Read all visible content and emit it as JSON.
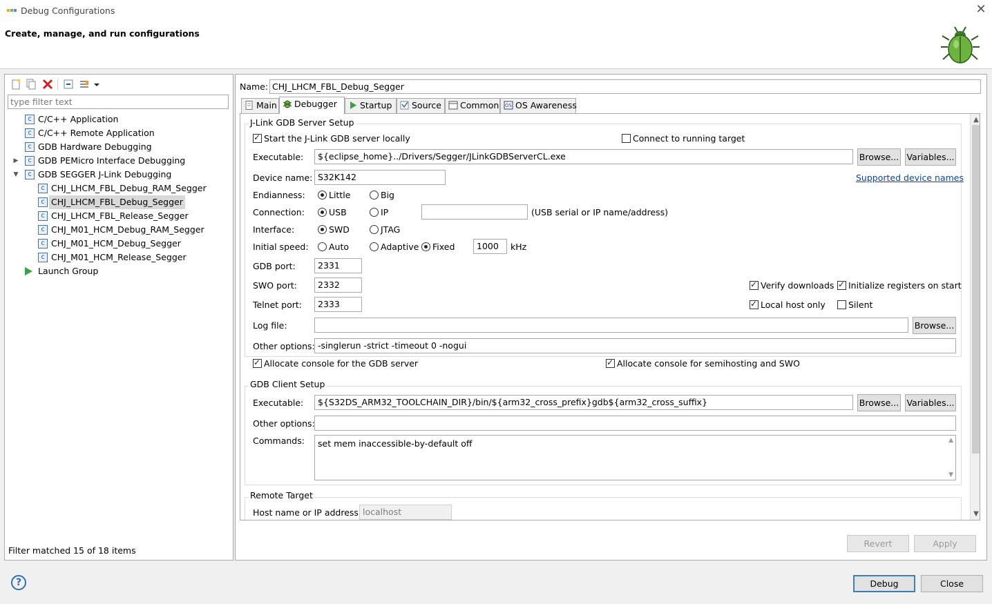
{
  "window": {
    "title": "Debug Configurations",
    "close_icon": "close-icon"
  },
  "header": {
    "title": "Create, manage, and run configurations"
  },
  "left": {
    "filter_placeholder": "type filter text",
    "tree": [
      {
        "label": "C/C++ Application",
        "level": 1
      },
      {
        "label": "C/C++ Remote Application",
        "level": 1
      },
      {
        "label": "GDB Hardware Debugging",
        "level": 1
      },
      {
        "label": "GDB PEMicro Interface Debugging",
        "level": 1,
        "expander": "collapsed"
      },
      {
        "label": "GDB SEGGER J-Link Debugging",
        "level": 1,
        "expander": "expanded"
      },
      {
        "label": "CHJ_LHCM_FBL_Debug_RAM_Segger",
        "level": 2
      },
      {
        "label": "CHJ_LHCM_FBL_Debug_Segger",
        "level": 2,
        "selected": true
      },
      {
        "label": "CHJ_LHCM_FBL_Release_Segger",
        "level": 2
      },
      {
        "label": "CHJ_M01_HCM_Debug_RAM_Segger",
        "level": 2
      },
      {
        "label": "CHJ_M01_HCM_Debug_Segger",
        "level": 2
      },
      {
        "label": "CHJ_M01_HCM_Release_Segger",
        "level": 2
      },
      {
        "label": "Launch Group",
        "level": 1
      }
    ],
    "status": "Filter matched 15 of 18 items"
  },
  "right": {
    "name_label": "Name:",
    "name_value": "CHJ_LHCM_FBL_Debug_Segger",
    "tabs": [
      "Main",
      "Debugger",
      "Startup",
      "Source",
      "Common",
      "OS Awareness"
    ],
    "active_tab": "Debugger",
    "server": {
      "group_title": "J-Link GDB Server Setup",
      "start_locally": "Start the J-Link GDB server locally",
      "connect_running": "Connect to running target",
      "executable_label": "Executable:",
      "executable_value": "${eclipse_home}../Drivers/Segger/JLinkGDBServerCL.exe",
      "browse": "Browse...",
      "variables": "Variables...",
      "device_label": "Device name:",
      "device_value": "S32K142",
      "supported_link": "Supported device names",
      "endian_label": "Endianness:",
      "endian_little": "Little",
      "endian_big": "Big",
      "conn_label": "Connection:",
      "conn_usb": "USB",
      "conn_ip": "IP",
      "conn_hint": "(USB serial or IP name/address)",
      "iface_label": "Interface:",
      "iface_swd": "SWD",
      "iface_jtag": "JTAG",
      "speed_label": "Initial speed:",
      "speed_auto": "Auto",
      "speed_adaptive": "Adaptive",
      "speed_fixed": "Fixed",
      "speed_value": "1000",
      "speed_unit": "kHz",
      "gdb_port_label": "GDB port:",
      "gdb_port": "2331",
      "swo_port_label": "SWO port:",
      "swo_port": "2332",
      "telnet_port_label": "Telnet port:",
      "telnet_port": "2333",
      "verify": "Verify downloads",
      "init_regs": "Initialize registers on start",
      "local_only": "Local host only",
      "silent": "Silent",
      "log_label": "Log file:",
      "log_browse": "Browse...",
      "other_label": "Other options:",
      "other_value": "-singlerun -strict -timeout 0 -nogui",
      "alloc_gdb": "Allocate console for the GDB server",
      "alloc_semi": "Allocate console for semihosting and SWO"
    },
    "client": {
      "group_title": "GDB Client Setup",
      "executable_label": "Executable:",
      "executable_value": "${S32DS_ARM32_TOOLCHAIN_DIR}/bin/${arm32_cross_prefix}gdb${arm32_cross_suffix}",
      "browse": "Browse...",
      "variables": "Variables...",
      "other_label": "Other options:",
      "commands_label": "Commands:",
      "commands_value": "set mem inaccessible-by-default off"
    },
    "remote": {
      "group_title": "Remote Target",
      "host_label": "Host name or IP address:",
      "host_value": "localhost"
    },
    "revert": "Revert",
    "apply": "Apply"
  },
  "footer": {
    "debug": "Debug",
    "close": "Close",
    "help_glyph": "?"
  }
}
